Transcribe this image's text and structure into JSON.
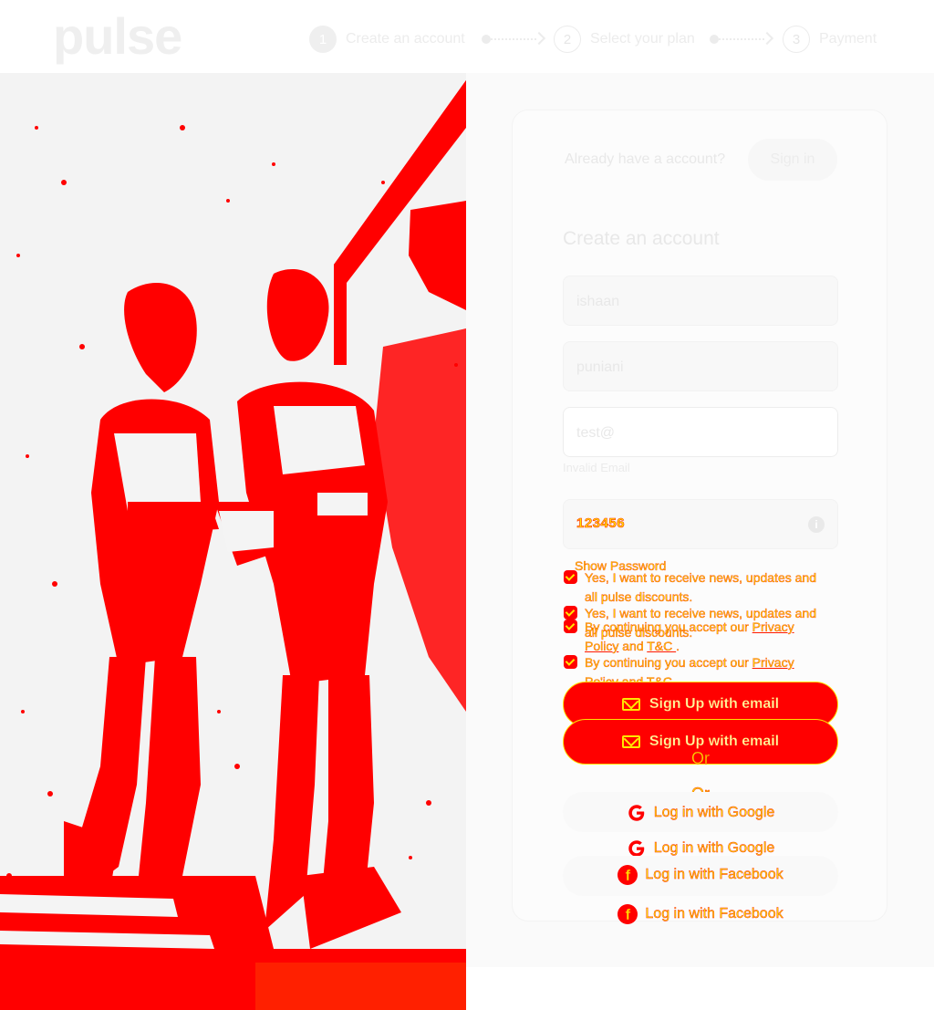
{
  "header": {
    "logo": "pulse",
    "steps": [
      {
        "num": "1",
        "label": "Create an account"
      },
      {
        "num": "2",
        "label": "Select your plan"
      },
      {
        "num": "3",
        "label": "Payment"
      }
    ]
  },
  "account": {
    "already_text": "Already have a account?",
    "signin_label": "Sign in"
  },
  "form": {
    "title": "Create an account",
    "first_name": "ishaan",
    "last_name": "puniani",
    "email": "test@",
    "email_error": "Invalid Email",
    "password": "123456",
    "show_password": "Show Password",
    "news_text_1": "Yes, I want to receive news, updates and",
    "news_text_2": "all pulse discounts.",
    "terms_prefix": "By continuing you accept our ",
    "terms_privacy_1": "Privacy",
    "terms_privacy_2": "Policy",
    "terms_and": " and ",
    "terms_tc_1": "T&C ",
    "terms_tc_2": "T&C",
    "terms_suffix": ".",
    "terms_line2_prefix": "Po'icy",
    "signup_label": "Sign Up with email",
    "or_label": "Or",
    "google_label": "Log in with Google",
    "facebook_label": "Log in with Facebook"
  },
  "colors": {
    "overlay_red": "#ff0000",
    "overlay_yellow": "#f7e300",
    "muted": "#ececec"
  }
}
